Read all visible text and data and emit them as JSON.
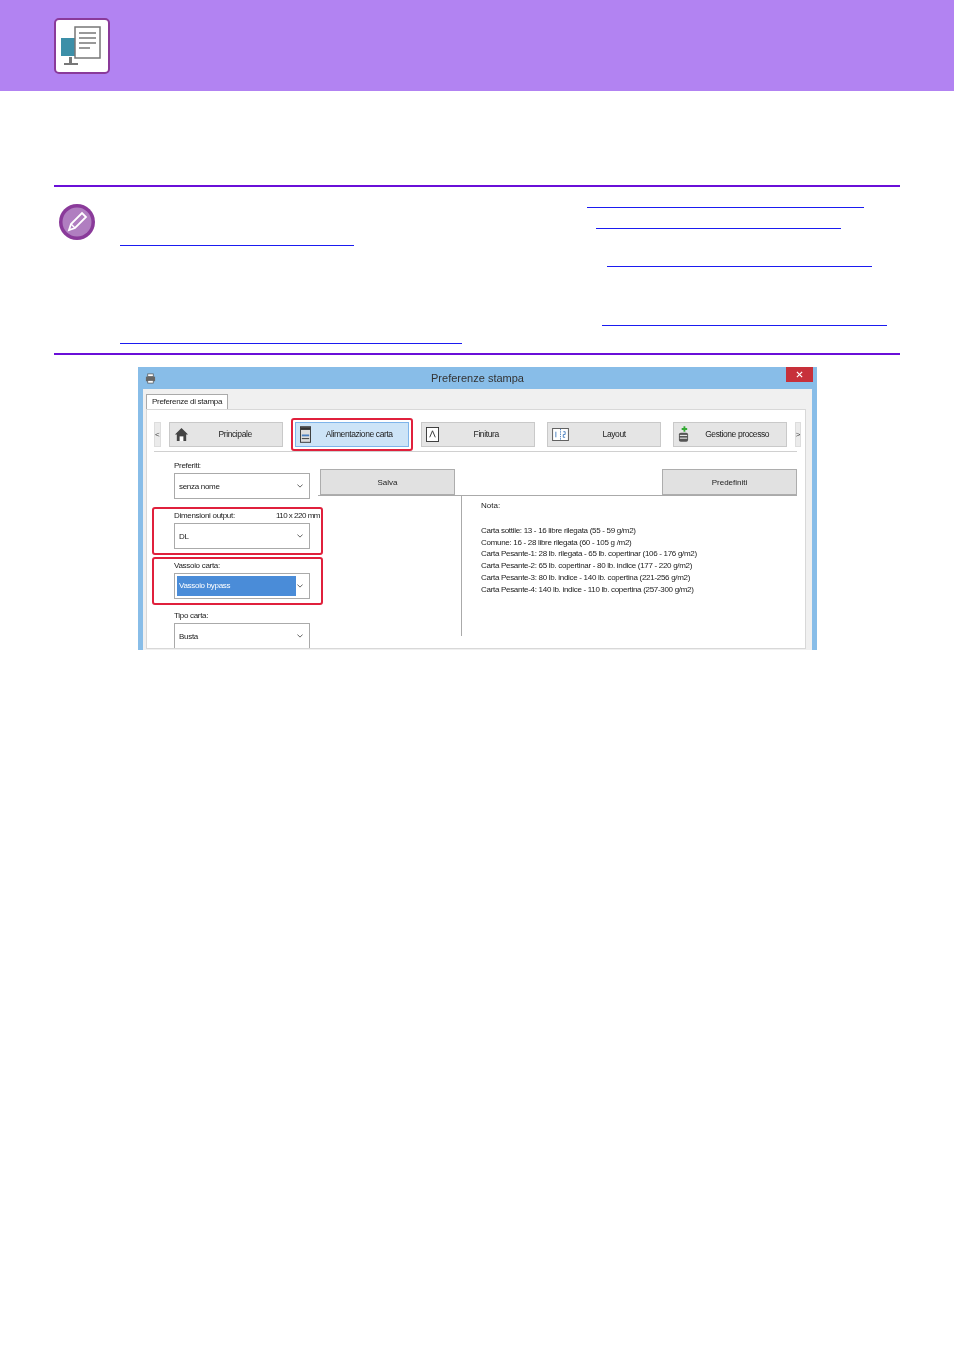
{
  "dialog": {
    "title": "Preferenze stampa",
    "sheet_tab": "Preferenze di stampa",
    "nav_prev": "<",
    "nav_next": ">",
    "tabs": [
      {
        "label": "Principale",
        "kind": "home",
        "selected": false,
        "highlighted": false
      },
      {
        "label": "Alimentazione carta",
        "kind": "printer",
        "selected": true,
        "highlighted": true
      },
      {
        "label": "Finitura",
        "kind": "page",
        "selected": false,
        "highlighted": false
      },
      {
        "label": "Layout",
        "kind": "split",
        "selected": false,
        "highlighted": false
      },
      {
        "label": "Gestione processo",
        "kind": "stack",
        "selected": false,
        "highlighted": false
      }
    ],
    "favorites": {
      "label": "Preferiti:",
      "value": "senza nome"
    },
    "buttons": [
      "Salva",
      "Predefiniti"
    ],
    "fields": [
      {
        "label": "Dimensioni output:",
        "reading": "110 x 220 mm",
        "value": "DL",
        "highlighted": true,
        "focused": false
      },
      {
        "label": "Vassoio carta:",
        "value": "Vassoio bypass",
        "highlighted": true,
        "focused": true
      },
      {
        "label": "Tipo carta:",
        "value": "Busta",
        "highlighted": false,
        "focused": false
      }
    ],
    "note": {
      "title": "Nota:",
      "lines": [
        "Carta sottile: 13 - 16 libre rilegata (55 - 59 g/m2)",
        "Comune: 16 - 28 libre rilegata (60 - 105 g /m2)",
        "Carta Pesante-1: 28 lb. rilegata - 65 lb. copertinar (106 - 176 g/m2)",
        "Carta Pesante-2: 65 lb. copertinar - 80 lb. indice (177 - 220 g/m2)",
        "Carta Pesante-3: 80 lb. indice - 140 lb. copertina (221-256 g/m2)",
        "Carta Pesante-4: 140 lb. indice - 110 lb. copertina (257-300 g/m2)"
      ]
    }
  }
}
